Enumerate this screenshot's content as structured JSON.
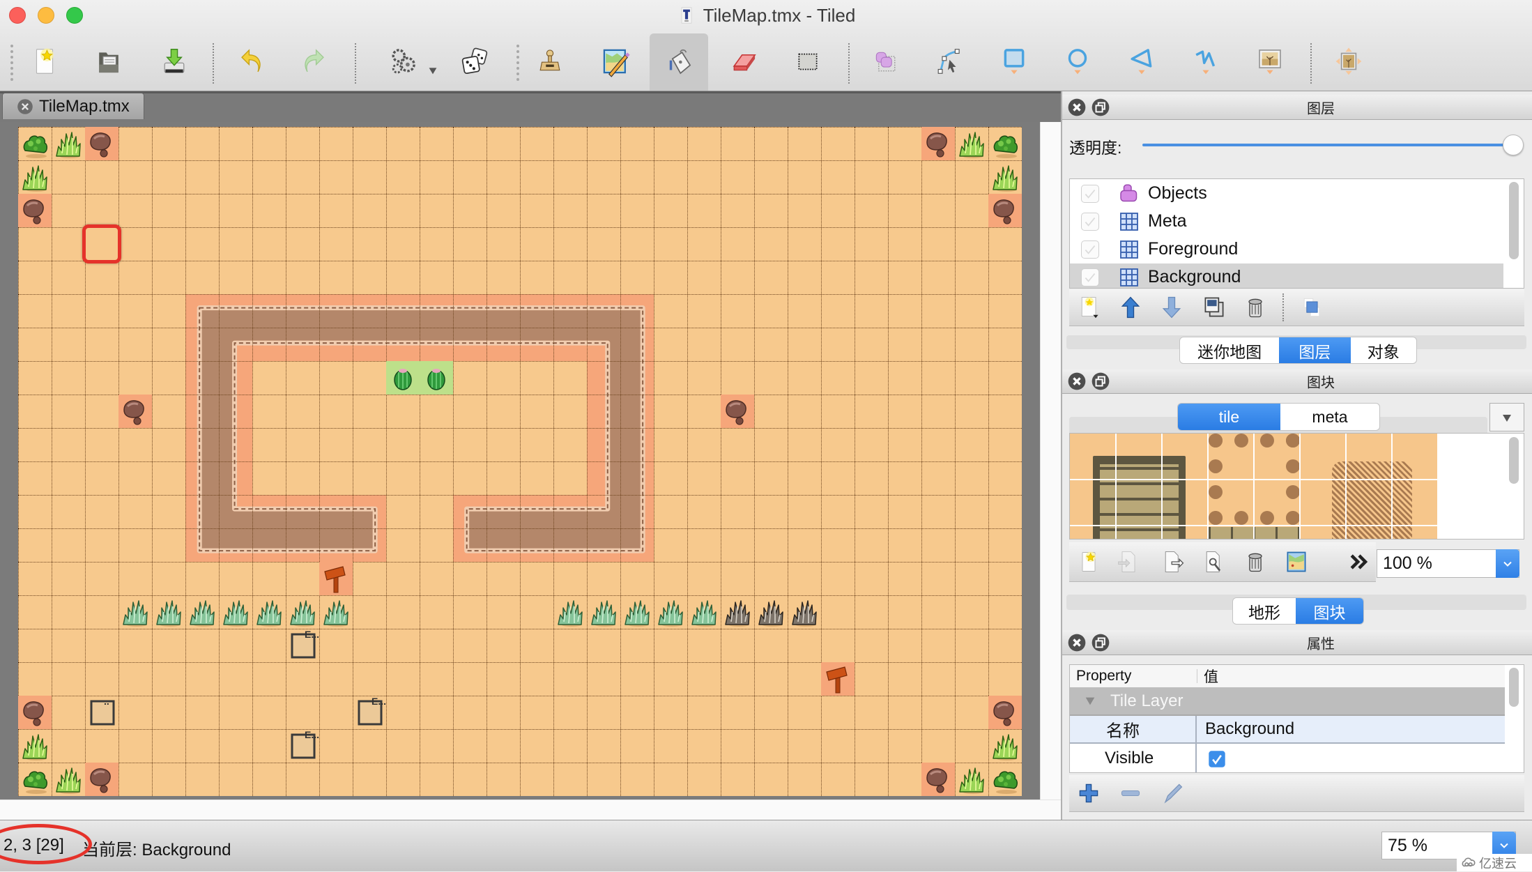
{
  "window": {
    "title": "TileMap.tmx - Tiled",
    "title_icon": "tiled-app-icon",
    "controls": [
      "close",
      "minimize",
      "zoom"
    ]
  },
  "toolbar": {
    "items": [
      {
        "id": "new-map",
        "icon": "new-document-icon",
        "enabled": true
      },
      {
        "id": "open-map",
        "icon": "open-folder-icon",
        "enabled": true
      },
      {
        "id": "save-map",
        "icon": "save-icon",
        "enabled": true
      },
      {
        "id": "undo",
        "icon": "undo-icon",
        "enabled": true
      },
      {
        "id": "redo",
        "icon": "redo-icon",
        "enabled": false
      },
      {
        "id": "commands",
        "icon": "gears-icon",
        "enabled": true,
        "has_dropdown": true
      },
      {
        "id": "random-mode",
        "icon": "dice-icon",
        "enabled": true
      },
      {
        "id": "stamp-brush",
        "icon": "stamp-icon",
        "enabled": true
      },
      {
        "id": "terrain-brush",
        "icon": "terrain-brush-icon",
        "enabled": true
      },
      {
        "id": "bucket-fill",
        "icon": "bucket-fill-icon",
        "enabled": true,
        "active": true
      },
      {
        "id": "eraser",
        "icon": "eraser-icon",
        "enabled": true
      },
      {
        "id": "rectangular-select",
        "icon": "rect-select-icon",
        "enabled": true
      },
      {
        "id": "select-objects",
        "icon": "select-objects-icon",
        "enabled": true
      },
      {
        "id": "edit-polygons",
        "icon": "edit-polygons-icon",
        "enabled": true
      },
      {
        "id": "insert-rectangle",
        "icon": "insert-rectangle-icon",
        "enabled": true
      },
      {
        "id": "insert-ellipse",
        "icon": "insert-ellipse-icon",
        "enabled": true
      },
      {
        "id": "insert-polygon",
        "icon": "insert-polygon-icon",
        "enabled": true
      },
      {
        "id": "insert-polyline",
        "icon": "insert-polyline-icon",
        "enabled": true
      },
      {
        "id": "insert-tile",
        "icon": "insert-tile-icon",
        "enabled": true
      },
      {
        "id": "move-image",
        "icon": "image-move-icon",
        "enabled": true
      }
    ]
  },
  "document_tabs": [
    {
      "label": "TileMap.tmx",
      "close_icon": "tab-close-icon",
      "active": true
    }
  ],
  "map": {
    "cols": 30,
    "rows": 20,
    "walled_area": {
      "col_range": [
        5,
        18
      ],
      "row_range": [
        5,
        12
      ],
      "interior_col_range": [
        7,
        16
      ],
      "interior_row_range": [
        7,
        10
      ],
      "entrance_col_range": [
        11,
        12
      ]
    },
    "highlighted_tile": {
      "col": 2,
      "row": 3
    },
    "features": [
      {
        "type": "bush",
        "col": 0,
        "row": 0
      },
      {
        "type": "grass",
        "col": 1,
        "row": 0
      },
      {
        "type": "rock",
        "col": 2,
        "row": 0
      },
      {
        "type": "rock",
        "col": 27,
        "row": 0
      },
      {
        "type": "grass",
        "col": 28,
        "row": 0
      },
      {
        "type": "bush",
        "col": 29,
        "row": 0
      },
      {
        "type": "grass",
        "col": 0,
        "row": 1
      },
      {
        "type": "grass",
        "col": 29,
        "row": 1
      },
      {
        "type": "rock",
        "col": 0,
        "row": 2
      },
      {
        "type": "rock",
        "col": 29,
        "row": 2
      },
      {
        "type": "cactus",
        "col": 11,
        "row": 7
      },
      {
        "type": "cactus",
        "col": 12,
        "row": 7
      },
      {
        "type": "rock",
        "col": 3,
        "row": 8
      },
      {
        "type": "rock",
        "col": 21,
        "row": 8
      },
      {
        "type": "sign",
        "col": 9,
        "row": 13
      },
      {
        "type": "shrub",
        "col": 3,
        "row": 14
      },
      {
        "type": "shrub",
        "col": 4,
        "row": 14
      },
      {
        "type": "shrub",
        "col": 5,
        "row": 14
      },
      {
        "type": "shrub",
        "col": 6,
        "row": 14
      },
      {
        "type": "shrub",
        "col": 7,
        "row": 14
      },
      {
        "type": "shrub",
        "col": 8,
        "row": 14
      },
      {
        "type": "shrub",
        "col": 9,
        "row": 14
      },
      {
        "type": "shrub",
        "col": 16,
        "row": 14
      },
      {
        "type": "shrub",
        "col": 17,
        "row": 14
      },
      {
        "type": "shrub",
        "col": 18,
        "row": 14
      },
      {
        "type": "shrub",
        "col": 19,
        "row": 14
      },
      {
        "type": "shrub",
        "col": 20,
        "row": 14
      },
      {
        "type": "dead-shrub",
        "col": 21,
        "row": 14
      },
      {
        "type": "dead-shrub",
        "col": 22,
        "row": 14
      },
      {
        "type": "dead-shrub",
        "col": 23,
        "row": 14
      },
      {
        "type": "object",
        "col": 8,
        "row": 15,
        "label": "E..."
      },
      {
        "type": "sign",
        "col": 24,
        "row": 16
      },
      {
        "type": "rock",
        "col": 0,
        "row": 17
      },
      {
        "type": "object",
        "col": 2,
        "row": 17,
        "label": ".."
      },
      {
        "type": "object",
        "col": 10,
        "row": 17,
        "label": "E..."
      },
      {
        "type": "rock",
        "col": 29,
        "row": 17
      },
      {
        "type": "grass",
        "col": 0,
        "row": 18
      },
      {
        "type": "object",
        "col": 8,
        "row": 18,
        "label": "E..."
      },
      {
        "type": "grass",
        "col": 29,
        "row": 18
      },
      {
        "type": "bush",
        "col": 0,
        "row": 19
      },
      {
        "type": "grass",
        "col": 1,
        "row": 19
      },
      {
        "type": "rock",
        "col": 2,
        "row": 19
      },
      {
        "type": "rock",
        "col": 27,
        "row": 19
      },
      {
        "type": "grass",
        "col": 28,
        "row": 19
      },
      {
        "type": "bush",
        "col": 29,
        "row": 19
      }
    ]
  },
  "layers_panel": {
    "title": "图层",
    "opacity_label": "透明度:",
    "opacity": 1.0,
    "layers": [
      {
        "name": "Objects",
        "type": "object",
        "icon": "object-layer-icon",
        "visible": true
      },
      {
        "name": "Meta",
        "type": "tile",
        "icon": "tile-layer-icon",
        "visible": true
      },
      {
        "name": "Foreground",
        "type": "tile",
        "icon": "tile-layer-icon",
        "visible": true
      },
      {
        "name": "Background",
        "type": "tile",
        "icon": "tile-layer-icon",
        "visible": true,
        "selected": true
      }
    ],
    "toolbar_icons": [
      "add-layer-icon",
      "raise-layer-icon",
      "lower-layer-icon",
      "duplicate-layer-icon",
      "delete-layer-icon",
      "toggle-other-layers-icon"
    ],
    "tabs": [
      "迷你地图",
      "图层",
      "对象"
    ],
    "active_tab": "图层"
  },
  "tilesets_panel": {
    "title": "图块",
    "tabs": [
      "tile",
      "meta"
    ],
    "active_tab": "tile",
    "toolbar_icons": [
      "new-tileset-icon",
      "import-tileset-icon",
      "export-tileset-icon",
      "tileset-properties-icon",
      "delete-tileset-icon",
      "edit-terrain-icon",
      "overflow-chevron-icon"
    ],
    "zoom": "100 %",
    "bottom_tabs": [
      "地形",
      "图块"
    ],
    "active_bottom_tab": "图块"
  },
  "properties_panel": {
    "title": "属性",
    "columns": [
      "Property",
      "值"
    ],
    "group": "Tile Layer",
    "rows": [
      {
        "key": "名称",
        "value": "Background"
      },
      {
        "key": "Visible",
        "value": true
      }
    ],
    "toolbar_icons": [
      "add-property-icon",
      "remove-property-icon",
      "rename-property-icon"
    ]
  },
  "status": {
    "coords": "2, 3 [29]",
    "current_layer": "当前层: Background",
    "zoom": "75 %"
  },
  "watermark": "亿速云",
  "colors": {
    "accent": "#2f80e6",
    "sand": "#f7c98d",
    "highlight_red": "#e5322a"
  }
}
